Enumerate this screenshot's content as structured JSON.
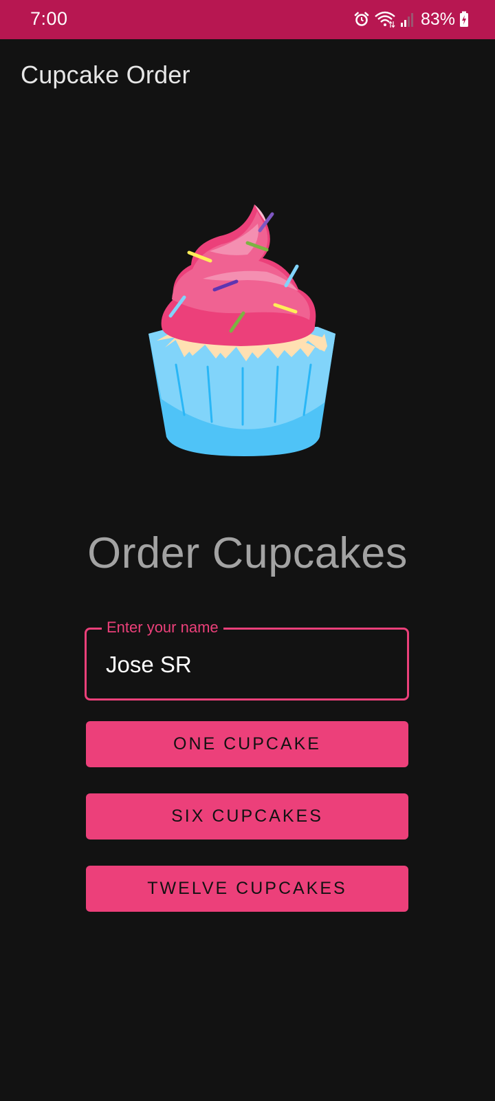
{
  "status_bar": {
    "time": "7:00",
    "battery_percent": "83%",
    "icons": [
      "alarm-icon",
      "wifi-icon",
      "signal-icon",
      "battery-charging-icon"
    ],
    "background_color": "#b71751"
  },
  "app_bar": {
    "title": "Cupcake Order"
  },
  "hero_image": {
    "icon": "cupcake-image"
  },
  "main": {
    "heading": "Order Cupcakes",
    "name_field": {
      "label": "Enter your name",
      "value": "Jose SR"
    },
    "buttons": [
      {
        "label": "ONE CUPCAKE"
      },
      {
        "label": "SIX CUPCAKES"
      },
      {
        "label": "TWELVE CUPCAKES"
      }
    ]
  },
  "colors": {
    "accent": "#ec407a",
    "background": "#121212",
    "heading_text": "#a3a3a3"
  }
}
